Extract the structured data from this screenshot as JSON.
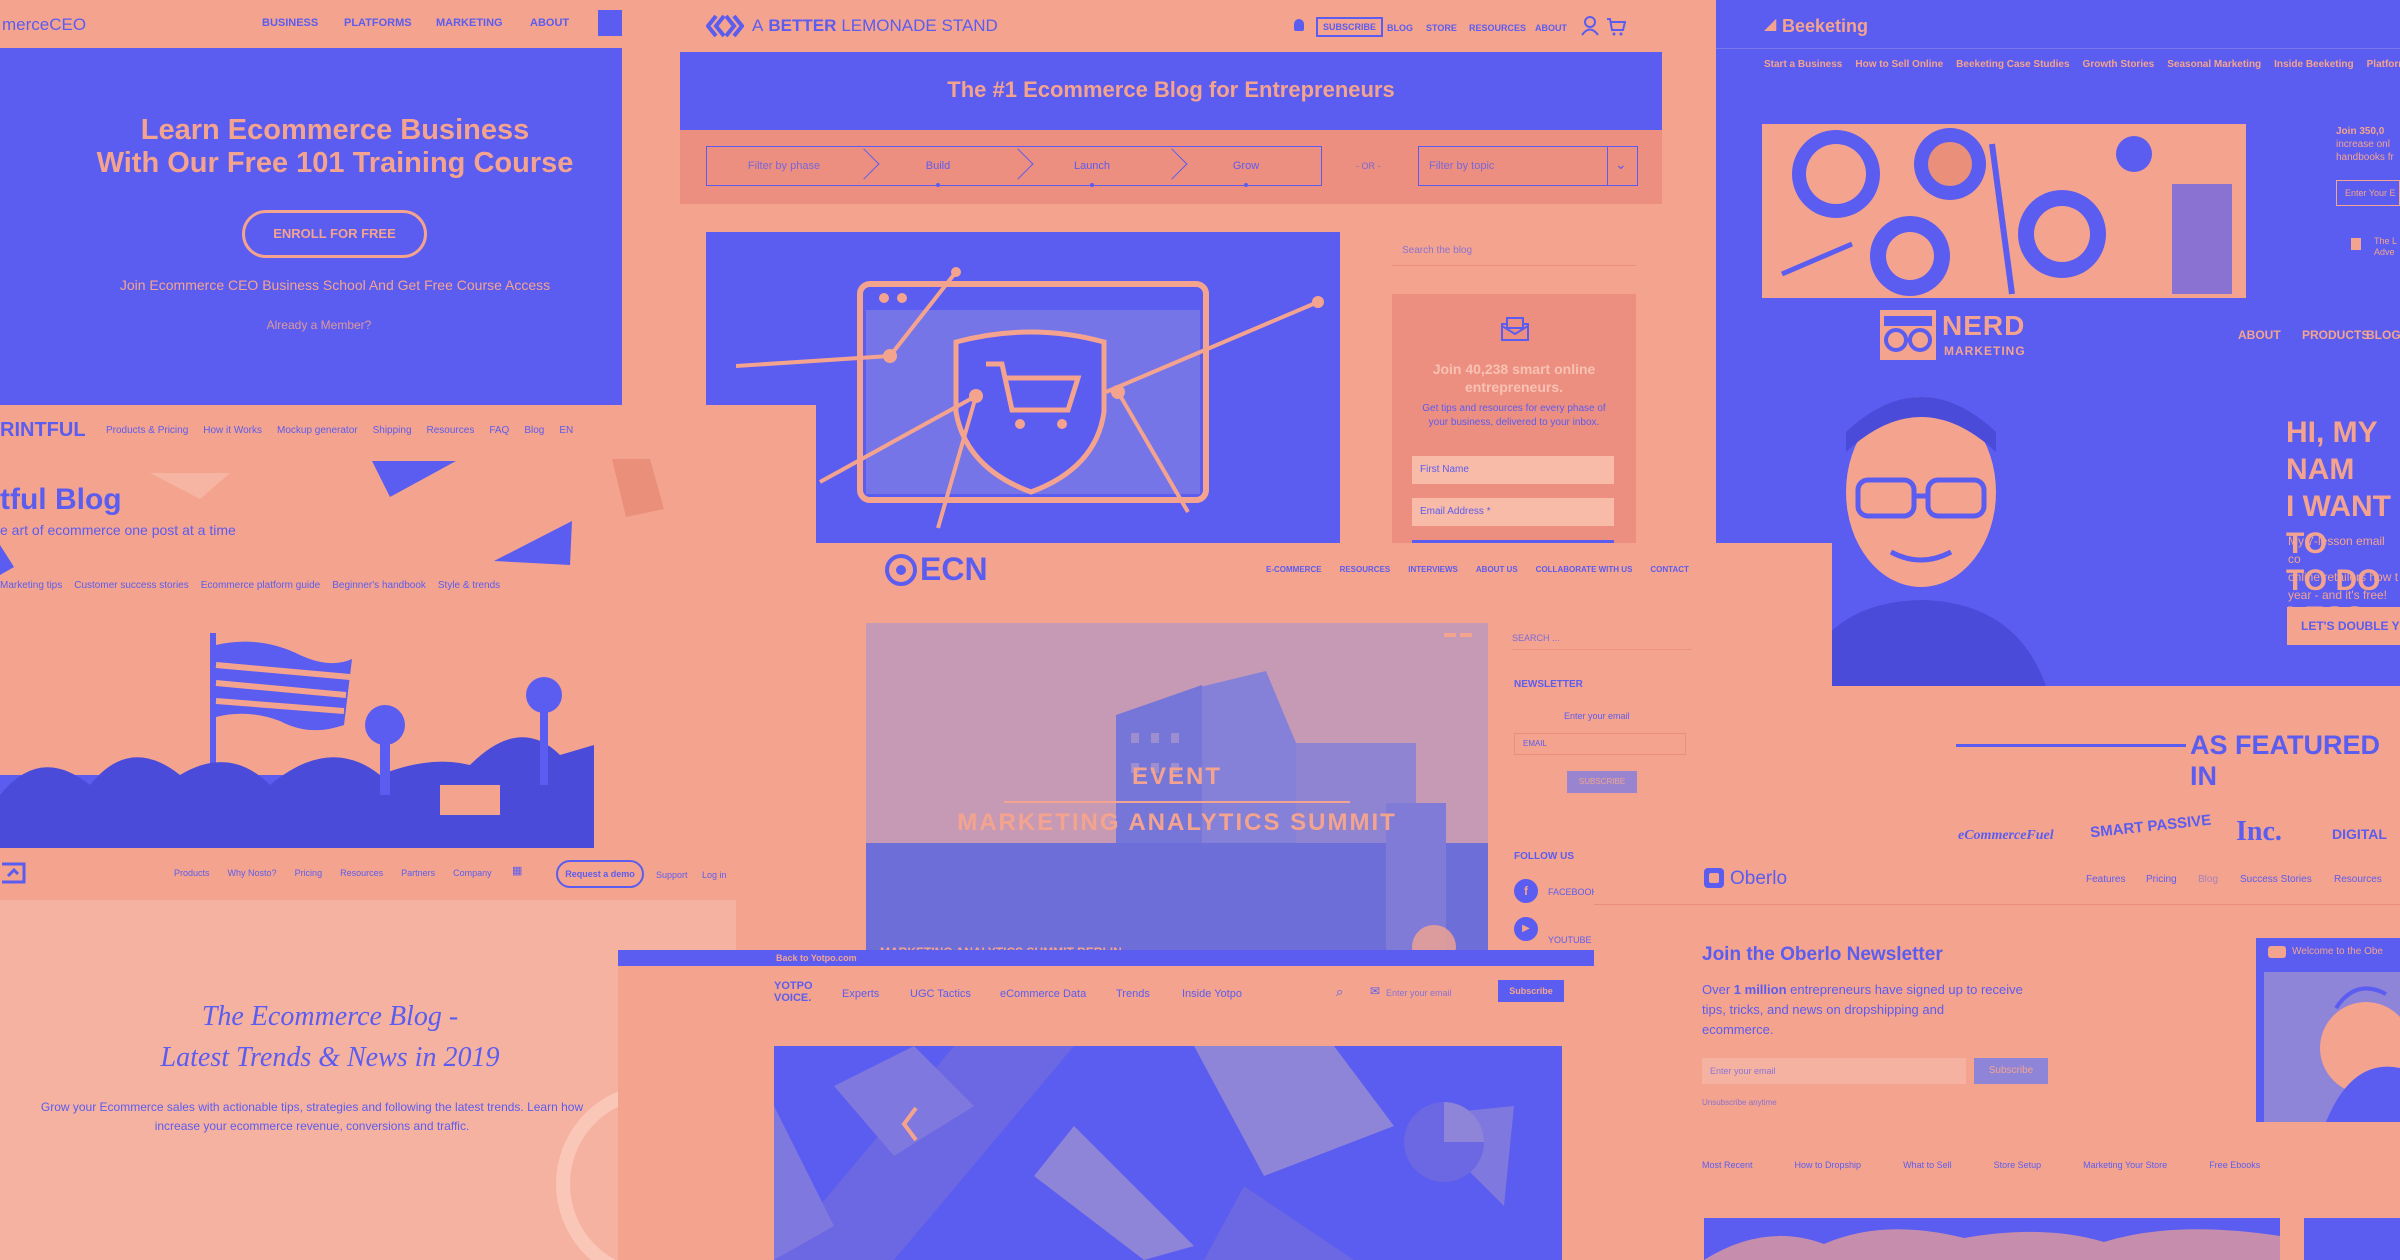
{
  "colors": {
    "blue": "#5B5CF0",
    "salmon": "#F4A48E",
    "blue_dark": "#4A4BD8",
    "salmon_dark": "#E98F7A"
  },
  "p1": {
    "logo": "merceCEO",
    "nav": [
      "BUSINESS",
      "PLATFORMS",
      "MARKETING",
      "ABOUT"
    ],
    "title_line1": "Learn Ecommerce Business",
    "title_line2": "With Our Free 101 Training Course",
    "cta": "ENROLL FOR FREE",
    "sub": "Join Ecommerce CEO Business School And Get Free Course Access",
    "member": "Already a Member?"
  },
  "p2": {
    "logo_a": "A",
    "logo_b": "BETTER",
    "logo_c": "LEMONADE STAND",
    "nav": [
      "SUBSCRIBE",
      "BLOG",
      "STORE",
      "RESOURCES",
      "ABOUT"
    ],
    "banner": "The #1 Ecommerce Blog for Entrepreneurs",
    "phases": [
      "Filter by phase",
      "Build",
      "Launch",
      "Grow"
    ],
    "or": "- OR -",
    "topic": "Filter by topic",
    "search": "Search the blog",
    "join_line1": "Join 40,238 smart online",
    "join_line2": "entrepreneurs.",
    "tips_line1": "Get tips and resources for every phase of",
    "tips_line2": "your business, delivered to your inbox.",
    "first_name": "First Name",
    "email": "Email Address *"
  },
  "p3": {
    "logo": "Beeketing",
    "nav": [
      "Start a Business",
      "How to Sell Online",
      "Beeketing Case Studies",
      "Growth Stories",
      "Seasonal Marketing",
      "Inside Beeketing",
      "Platforms"
    ],
    "side_line1": "Join 350,0",
    "side_line2": "increase onl",
    "side_line3": "handbooks fr",
    "enter": "Enter Your E",
    "side_item1": "The L",
    "side_item2": "Adve"
  },
  "p4": {
    "logo_a": "NERD",
    "logo_b": "MARKETING",
    "nav": [
      "ABOUT",
      "PRODUCTS",
      "BLOG"
    ],
    "hero_line1": "HI, MY NAM",
    "hero_line2": "I WANT TO",
    "hero_line3": "TO DO LESS",
    "body_line1": "My 7-lesson email co",
    "body_line2": "online retailers how t",
    "body_line3": "year - and it's free!",
    "cta": "LET'S DOUBLE Y",
    "featured": "AS FEATURED IN",
    "press": [
      "eCommerceFuel",
      "SMART PASSIVE",
      "Inc.",
      "DIGITAL"
    ]
  },
  "p5": {
    "logo": "RINTFUL",
    "nav": [
      "Products & Pricing",
      "How it Works",
      "Mockup generator",
      "Shipping",
      "Resources",
      "FAQ",
      "Blog",
      "EN"
    ],
    "title": "tful Blog",
    "sub": "e art of ecommerce one post at a time",
    "cats": [
      "Marketing tips",
      "Customer success stories",
      "Ecommerce platform guide",
      "Beginner's handbook",
      "Style & trends"
    ]
  },
  "p6": {
    "logo": "ECN",
    "nav": [
      "E-COMMERCE",
      "RESOURCES",
      "INTERVIEWS",
      "ABOUT US",
      "COLLABORATE WITH US",
      "CONTACT"
    ],
    "event": "EVENT",
    "summit": "MARKETING ANALYTICS SUMMIT",
    "caption": "MARKETING ANALYTICS SUMMIT BERLIN",
    "search": "SEARCH ...",
    "newsletter": "NEWSLETTER",
    "enter_email": "Enter your email",
    "email": "EMAIL",
    "subscribe": "SUBSCRIBE",
    "follow": "FOLLOW US",
    "facebook": "FACEBOOK",
    "youtube": "YOUTUBE"
  },
  "p7": {
    "nav": [
      "Products",
      "Why Nosto?",
      "Pricing",
      "Resources",
      "Partners",
      "Company"
    ],
    "demo": "Request a demo",
    "support": "Support",
    "login": "Log in",
    "title_line1": "The Ecommerce Blog -",
    "title_line2": "Latest Trends & News in 2019",
    "body_line1": "Grow your Ecommerce sales with actionable tips, strategies and following the latest trends. Learn how",
    "body_line2": "increase your ecommerce revenue, conversions and traffic."
  },
  "p8": {
    "back": "Back to Yotpo.com",
    "logo_a": "YOTPO",
    "logo_b": "VOICE.",
    "nav": [
      "Experts",
      "UGC Tactics",
      "eCommerce Data",
      "Trends",
      "Inside Yotpo"
    ],
    "email": "Enter your email",
    "subscribe": "Subscribe"
  },
  "p9": {
    "logo": "Oberlo",
    "nav": [
      "Features",
      "Pricing",
      "Blog",
      "Success Stories",
      "Resources"
    ],
    "title": "Join the Oberlo Newsletter",
    "body_pre": "Over",
    "body_bold": "1 million",
    "body_line1": "entrepreneurs have signed up to receive",
    "body_line2": "tips, tricks, and news on dropshipping and",
    "body_line3": "ecommerce.",
    "email": "Enter your email",
    "subscribe": "Subscribe",
    "unsub": "Unsubscribe anytime",
    "welcome": "Welcome to the Obe",
    "tabs": [
      "Most Recent",
      "How to Dropship",
      "What to Sell",
      "Store Setup",
      "Marketing Your Store",
      "Free Ebooks"
    ]
  }
}
